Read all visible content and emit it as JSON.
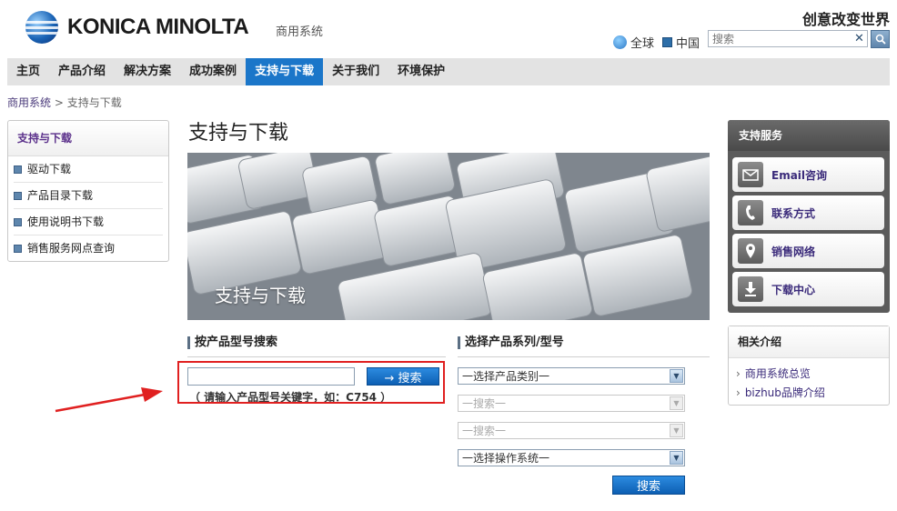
{
  "header": {
    "logo_text": "KONICA MINOLTA",
    "brand_sub": "商用系统",
    "slogan": "创意改变世界",
    "lang_global": "全球",
    "lang_china": "中国",
    "search_placeholder": "搜索"
  },
  "nav": {
    "items": [
      {
        "label": "主页"
      },
      {
        "label": "产品介绍"
      },
      {
        "label": "解决方案"
      },
      {
        "label": "成功案例"
      },
      {
        "label": "支持与下载"
      },
      {
        "label": "关于我们"
      },
      {
        "label": "环境保护"
      }
    ],
    "active_index": 4
  },
  "breadcrumb": {
    "root": "商用系统",
    "sep": ">",
    "current": "支持与下载"
  },
  "sidebar": {
    "title": "支持与下载",
    "items": [
      {
        "label": "驱动下载"
      },
      {
        "label": "产品目录下载"
      },
      {
        "label": "使用说明书下载"
      },
      {
        "label": "销售服务网点查询"
      }
    ]
  },
  "main": {
    "title": "支持与下载",
    "banner_text": "支持与下载",
    "model_search": {
      "title": "按产品型号搜索",
      "input_value": "",
      "button_label": "→ 搜索",
      "hint": "（ 请输入产品型号关键字，如：C754 ）"
    },
    "series_search": {
      "title": "选择产品系列/型号",
      "selects": [
        {
          "value": "一选择产品类别一",
          "disabled": false
        },
        {
          "value": "一搜索一",
          "disabled": true
        },
        {
          "value": "一搜索一",
          "disabled": true
        },
        {
          "value": "一选择操作系统一",
          "disabled": false
        }
      ],
      "button_label": "搜索"
    }
  },
  "right": {
    "services_title": "支持服务",
    "services": [
      {
        "label": "Email咨询",
        "icon": "envelope-icon"
      },
      {
        "label": "联系方式",
        "icon": "phone-icon"
      },
      {
        "label": "销售网络",
        "icon": "map-pin-icon"
      },
      {
        "label": "下载中心",
        "icon": "download-icon"
      }
    ],
    "related_title": "相关介绍",
    "related": [
      {
        "label": "商用系统总览"
      },
      {
        "label": "bizhub品牌介绍"
      }
    ]
  },
  "colors": {
    "accent": "#1b76c9",
    "annotation_red": "#e02020"
  }
}
